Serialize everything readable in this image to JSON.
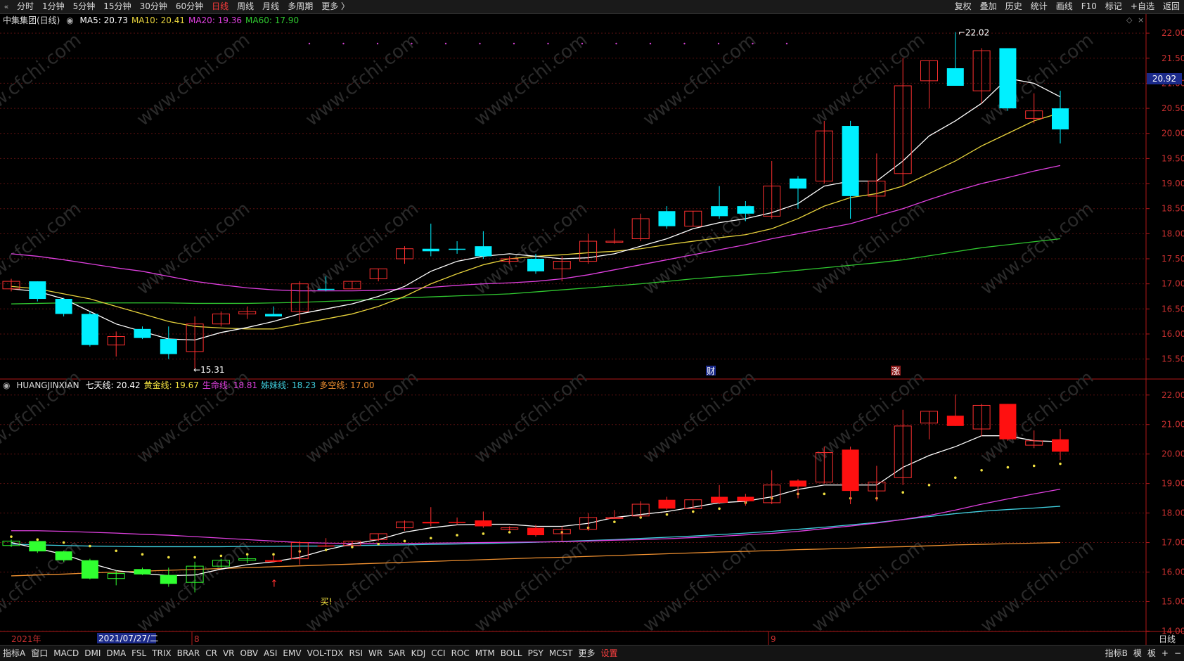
{
  "toolbar": {
    "back_icon": "double-chevron-left-icon",
    "periods": [
      "分时",
      "1分钟",
      "5分钟",
      "15分钟",
      "30分钟",
      "60分钟",
      "日线",
      "周线",
      "月线",
      "多周期",
      "更多 〉"
    ],
    "active_period": "日线",
    "right": [
      "复权",
      "叠加",
      "历史",
      "统计",
      "画线",
      "F10",
      "标记",
      "+自选",
      "返回"
    ]
  },
  "main_panel": {
    "title": "中集集团(日线)",
    "ma": [
      {
        "label": "MA5: 20.73",
        "color": "#ffffff"
      },
      {
        "label": "MA10: 20.41",
        "color": "#e6d23c"
      },
      {
        "label": "MA20: 19.36",
        "color": "#e040e0"
      },
      {
        "label": "MA60: 17.90",
        "color": "#30c830"
      }
    ],
    "current_price": "20.92",
    "high_label": "22.02",
    "low_label": "15.31",
    "event_markers": [
      "财",
      "涨"
    ],
    "y_ticks": [
      "22.00",
      "21.50",
      "21.00",
      "20.50",
      "20.00",
      "19.50",
      "19.00",
      "18.50",
      "18.00",
      "17.50",
      "17.00",
      "16.50",
      "16.00",
      "15.50"
    ]
  },
  "indicator_panel": {
    "name": "HUANGJINXIAN",
    "lines": [
      {
        "label": "七天线: 20.42",
        "color": "#ffffff"
      },
      {
        "label": "黄金线: 19.67",
        "color": "#f0e040"
      },
      {
        "label": "生命线: 18.81",
        "color": "#e040e0"
      },
      {
        "label": "姊妹线: 18.23",
        "color": "#40d0e0"
      },
      {
        "label": "多空线: 17.00",
        "color": "#f09030"
      }
    ],
    "buy_signal": "买!",
    "y_ticks": [
      "22.00",
      "21.00",
      "20.00",
      "19.00",
      "18.00",
      "17.00",
      "16.00",
      "15.00",
      "14.00"
    ]
  },
  "x_axis": {
    "year_label": "2021年",
    "cursor_date": "2021/07/27/二",
    "month_labels": [
      "8",
      "9"
    ],
    "period_label": "日线"
  },
  "bottom_tabs": {
    "left": [
      "指标A",
      "窗口",
      "MACD",
      "DMI",
      "DMA",
      "FSL",
      "TRIX",
      "BRAR",
      "CR",
      "VR",
      "OBV",
      "ASI",
      "EMV",
      "VOL-TDX",
      "RSI",
      "WR",
      "SAR",
      "KDJ",
      "CCI",
      "ROC",
      "MTM",
      "BOLL",
      "PSY",
      "MCST",
      "更多",
      "设置"
    ],
    "right": [
      "指标B",
      "模",
      "板",
      "+",
      "−"
    ]
  },
  "watermark": "www.cfchi.com",
  "chart_data": {
    "type": "candlestick",
    "candles": [
      [
        16.9,
        17.1,
        16.85,
        17.05
      ],
      [
        17.05,
        17.05,
        16.65,
        16.7
      ],
      [
        16.7,
        16.72,
        16.35,
        16.4
      ],
      [
        16.4,
        16.45,
        15.75,
        15.78
      ],
      [
        15.78,
        16.05,
        15.55,
        15.95
      ],
      [
        16.1,
        16.15,
        15.9,
        15.92
      ],
      [
        15.9,
        16.15,
        15.5,
        15.6
      ],
      [
        15.65,
        16.35,
        15.31,
        16.2
      ],
      [
        16.2,
        16.45,
        16.15,
        16.4
      ],
      [
        16.4,
        16.55,
        16.3,
        16.45
      ],
      [
        16.4,
        16.55,
        16.35,
        16.35
      ],
      [
        16.45,
        17.05,
        16.25,
        17.0
      ],
      [
        16.9,
        17.15,
        16.85,
        16.88
      ],
      [
        16.9,
        17.05,
        16.9,
        17.05
      ],
      [
        17.1,
        17.3,
        17.05,
        17.3
      ],
      [
        17.5,
        17.75,
        17.4,
        17.7
      ],
      [
        17.7,
        18.2,
        17.55,
        17.65
      ],
      [
        17.7,
        17.85,
        17.6,
        17.68
      ],
      [
        17.75,
        18.05,
        17.5,
        17.55
      ],
      [
        17.45,
        17.55,
        17.4,
        17.5
      ],
      [
        17.5,
        17.6,
        17.2,
        17.25
      ],
      [
        17.3,
        17.55,
        17.05,
        17.45
      ],
      [
        17.45,
        18.0,
        17.4,
        17.85
      ],
      [
        17.85,
        18.1,
        17.8,
        17.85
      ],
      [
        17.9,
        18.4,
        17.85,
        18.3
      ],
      [
        18.45,
        18.55,
        18.1,
        18.15
      ],
      [
        18.15,
        18.45,
        18.15,
        18.45
      ],
      [
        18.55,
        18.95,
        18.3,
        18.35
      ],
      [
        18.55,
        18.65,
        18.25,
        18.4
      ],
      [
        18.35,
        19.45,
        18.3,
        18.95
      ],
      [
        19.1,
        19.15,
        18.5,
        18.9
      ],
      [
        19.05,
        20.25,
        19.0,
        20.05
      ],
      [
        20.15,
        20.25,
        18.3,
        18.75
      ],
      [
        18.75,
        19.6,
        18.4,
        19.05
      ],
      [
        19.2,
        21.5,
        18.95,
        20.95
      ],
      [
        21.05,
        21.45,
        20.5,
        21.45
      ],
      [
        21.3,
        22.02,
        20.95,
        20.95
      ],
      [
        20.85,
        21.7,
        20.6,
        21.65
      ],
      [
        21.7,
        21.7,
        20.45,
        20.5
      ],
      [
        20.3,
        20.8,
        20.2,
        20.45
      ],
      [
        20.5,
        20.85,
        19.8,
        20.08
      ]
    ],
    "ma5": [
      16.9,
      16.85,
      16.7,
      16.45,
      16.2,
      16.05,
      15.9,
      15.88,
      16.03,
      16.13,
      16.25,
      16.4,
      16.5,
      16.6,
      16.75,
      16.95,
      17.25,
      17.45,
      17.55,
      17.6,
      17.55,
      17.5,
      17.52,
      17.6,
      17.75,
      17.9,
      18.1,
      18.22,
      18.3,
      18.42,
      18.6,
      18.95,
      19.05,
      19.05,
      19.45,
      19.95,
      20.25,
      20.6,
      21.1,
      21.0,
      20.73
    ],
    "ma10": [
      16.95,
      16.9,
      16.8,
      16.7,
      16.55,
      16.4,
      16.25,
      16.15,
      16.12,
      16.1,
      16.1,
      16.2,
      16.3,
      16.4,
      16.55,
      16.75,
      17.0,
      17.2,
      17.38,
      17.5,
      17.55,
      17.58,
      17.62,
      17.65,
      17.7,
      17.78,
      17.85,
      17.92,
      17.98,
      18.1,
      18.3,
      18.55,
      18.72,
      18.8,
      18.95,
      19.2,
      19.45,
      19.75,
      20.0,
      20.25,
      20.41
    ],
    "ma20": [
      17.6,
      17.55,
      17.48,
      17.4,
      17.32,
      17.25,
      17.15,
      17.05,
      16.98,
      16.92,
      16.88,
      16.86,
      16.86,
      16.86,
      16.87,
      16.9,
      16.93,
      16.97,
      17.0,
      17.02,
      17.05,
      17.1,
      17.18,
      17.28,
      17.38,
      17.48,
      17.58,
      17.68,
      17.78,
      17.9,
      18.0,
      18.1,
      18.2,
      18.35,
      18.5,
      18.68,
      18.85,
      19.0,
      19.12,
      19.25,
      19.36
    ],
    "ma60": [
      16.6,
      16.61,
      16.62,
      16.62,
      16.62,
      16.62,
      16.62,
      16.61,
      16.61,
      16.61,
      16.62,
      16.63,
      16.65,
      16.67,
      16.69,
      16.72,
      16.74,
      16.76,
      16.78,
      16.8,
      16.84,
      16.88,
      16.92,
      16.96,
      17.0,
      17.05,
      17.1,
      17.14,
      17.18,
      17.22,
      17.27,
      17.32,
      17.37,
      17.42,
      17.48,
      17.56,
      17.64,
      17.72,
      17.78,
      17.84,
      17.9
    ],
    "y_range": [
      15.2,
      22.1
    ],
    "indicator": {
      "y_range": [
        13.7,
        22.4
      ],
      "qitian": [
        17.0,
        16.8,
        16.6,
        16.3,
        16.05,
        15.95,
        15.88,
        15.9,
        16.1,
        16.25,
        16.35,
        16.5,
        16.75,
        16.95,
        17.1,
        17.35,
        17.5,
        17.6,
        17.62,
        17.62,
        17.55,
        17.55,
        17.65,
        17.85,
        17.95,
        18.05,
        18.2,
        18.35,
        18.4,
        18.55,
        18.8,
        18.95,
        18.95,
        18.95,
        19.55,
        19.95,
        20.25,
        20.62,
        20.62,
        20.45,
        20.42
      ],
      "huangjin": [
        17.2,
        17.1,
        17.0,
        16.88,
        16.72,
        16.6,
        16.5,
        16.5,
        16.55,
        16.6,
        16.6,
        16.7,
        16.75,
        16.85,
        16.95,
        17.05,
        17.15,
        17.25,
        17.3,
        17.35,
        17.35,
        17.35,
        17.5,
        17.7,
        17.85,
        17.95,
        18.05,
        18.15,
        18.35,
        18.5,
        18.65,
        18.65,
        18.5,
        18.5,
        18.7,
        18.95,
        19.2,
        19.45,
        19.55,
        19.6,
        19.67
      ],
      "shengming": [
        17.4,
        17.4,
        17.38,
        17.35,
        17.32,
        17.28,
        17.25,
        17.2,
        17.15,
        17.1,
        17.05,
        17.0,
        16.98,
        16.97,
        16.97,
        16.97,
        16.98,
        16.99,
        17.0,
        17.01,
        17.02,
        17.03,
        17.05,
        17.08,
        17.1,
        17.13,
        17.17,
        17.21,
        17.26,
        17.31,
        17.38,
        17.47,
        17.56,
        17.66,
        17.78,
        17.92,
        18.1,
        18.3,
        18.48,
        18.65,
        18.81
      ],
      "zimei": [
        16.95,
        16.92,
        16.9,
        16.88,
        16.87,
        16.86,
        16.86,
        16.86,
        16.86,
        16.87,
        16.87,
        16.88,
        16.88,
        16.9,
        16.91,
        16.92,
        16.94,
        16.95,
        16.97,
        16.99,
        17.01,
        17.04,
        17.07,
        17.1,
        17.14,
        17.18,
        17.22,
        17.27,
        17.32,
        17.38,
        17.45,
        17.52,
        17.6,
        17.68,
        17.78,
        17.88,
        17.98,
        18.06,
        18.12,
        18.17,
        18.23
      ],
      "duokong": [
        15.87,
        15.9,
        15.93,
        15.97,
        16.0,
        16.03,
        16.06,
        16.09,
        16.12,
        16.15,
        16.18,
        16.21,
        16.24,
        16.27,
        16.3,
        16.33,
        16.36,
        16.39,
        16.42,
        16.45,
        16.48,
        16.5,
        16.53,
        16.56,
        16.59,
        16.62,
        16.65,
        16.68,
        16.7,
        16.73,
        16.76,
        16.78,
        16.81,
        16.84,
        16.86,
        16.89,
        16.92,
        16.94,
        16.96,
        16.98,
        17.0
      ]
    }
  }
}
